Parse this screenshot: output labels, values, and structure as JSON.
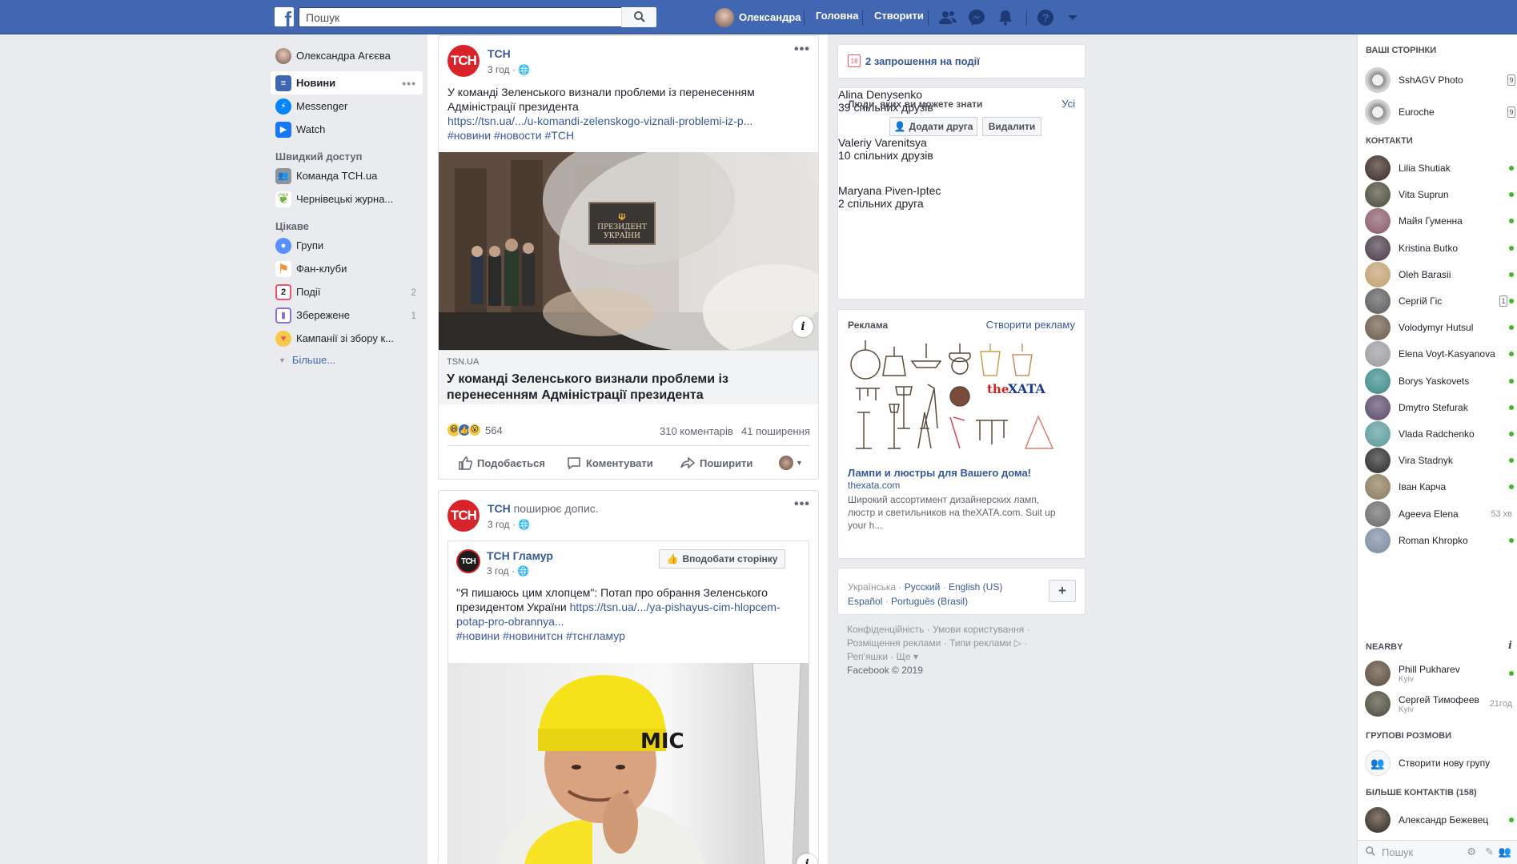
{
  "topbar": {
    "search_placeholder": "Пошук",
    "user_name": "Олександра",
    "home": "Головна",
    "create": "Створити"
  },
  "left": {
    "profile": "Олександра Агєєва",
    "nav": [
      {
        "label": "Новини",
        "icon": "news-feed-icon",
        "color": "#4267b2"
      },
      {
        "label": "Messenger",
        "icon": "messenger-icon",
        "color": "#0084ff"
      },
      {
        "label": "Watch",
        "icon": "watch-icon",
        "color": "#1877f2"
      }
    ],
    "shortcuts_title": "Швидкий доступ",
    "shortcuts": [
      {
        "label": "Команда TCH.ua",
        "icon": "group-icon",
        "color": "#8d949e"
      },
      {
        "label": "Чернівецькі журна...",
        "icon": "leaf-icon",
        "color": "#7cb342"
      }
    ],
    "explore_title": "Цікаве",
    "explore": [
      {
        "label": "Групи",
        "icon": "groups-icon",
        "color": "#5890ff",
        "count": ""
      },
      {
        "label": "Фан-клуби",
        "icon": "flag-icon",
        "color": "#f7923b",
        "count": ""
      },
      {
        "label": "Події",
        "icon": "calendar-icon",
        "color": "#f35369",
        "count": "2"
      },
      {
        "label": "Збережене",
        "icon": "bookmark-icon",
        "color": "#8c72cb",
        "count": "1"
      },
      {
        "label": "Кампанії зі збору к...",
        "icon": "fundraiser-icon",
        "color": "#f35369",
        "count": ""
      }
    ],
    "more": "Більше..."
  },
  "post1": {
    "author": "ТСН",
    "avatar_text": "ТСН",
    "time": "3 год",
    "text_line1": "У команді Зеленського визнали проблеми із перенесенням",
    "text_line2": "Адміністрації президента",
    "link": "https://tsn.ua/.../u-komandi-zelenskogo-viznali-problemi-iz-p...",
    "tags": "#новини #новости #ТСН",
    "plaque": "ПРЕЗИДЕНТ УКРАЇНИ",
    "domain": "TSN.UA",
    "headline_line1": "У команді Зеленського визнали проблеми із",
    "headline_line2": "перенесенням Адміністрації президента",
    "reactions": "564",
    "comments": "310 коментарів",
    "shares": "41 поширення",
    "like": "Подобається",
    "comment": "Коментувати",
    "share": "Поширити"
  },
  "post2": {
    "author": "ТСН",
    "avatar_text": "ТСН",
    "shared_text": "поширює допис.",
    "time": "3 год",
    "inner_author": "ТСН Гламур",
    "inner_avatar_text": "ТСН",
    "inner_time": "3 год",
    "like_page": "Вподобати сторінку",
    "text_line1": "\"Я пишаюсь цим хлопцем\": Потап про обрання Зеленського",
    "text_line2_plain": "президентом України",
    "text_line2_link": "https://tsn.ua/.../ya-pishayus-cim-hlopcem-",
    "text_line3_link": "potap-pro-obrannya...",
    "tags": "#новини #новинитсн #тснгламур"
  },
  "right": {
    "events": "2 запрошення на події",
    "events_day": "18",
    "pymk_title": "Люди, яких ви можете знати",
    "pymk_all": "Усі",
    "pymk": [
      {
        "name": "Alina Denysenko",
        "mutual": "39 спільних друзів",
        "color": "#6b5243"
      },
      {
        "name": "Valeriy Varenitsya",
        "mutual": "10 спільних друзів",
        "color": "#c9a98b"
      },
      {
        "name": "Maryana Piven-Iptec",
        "mutual": "2 спільних друга",
        "color": "#3b2a2a"
      }
    ],
    "add_friend": "Додати друга",
    "remove": "Видалити",
    "ads_title": "Реклама",
    "create_ad": "Створити рекламу",
    "ad_logo": "theXATA",
    "ad_title": "Лампи и люстры для Вашего дома!",
    "ad_domain": "thexata.com",
    "ad_desc_line1": "Широкий ассортимент дизайнерских ламп,",
    "ad_desc_line2": "люстр и светильников на theXATA.com. Suit up",
    "ad_desc_line3": "your h...",
    "lang_current": "Українська",
    "langs": [
      "Русский",
      "English (US)",
      "Español",
      "Português (Brasil)"
    ],
    "footer_line1": "Конфіденційність · Умови користування ·",
    "footer_line2": "Розміщення реклами · Типи реклами ▷ ·",
    "footer_line3": "Реп'яшки · Ще ▾",
    "copyright": "Facebook © 2019"
  },
  "chat": {
    "pages_title": "Ваші сторінки",
    "pages": [
      {
        "name": "SshAGV Photo",
        "badge": "9"
      },
      {
        "name": "Euroche",
        "badge": "9"
      }
    ],
    "contacts_title": "Контакти",
    "contacts": [
      {
        "name": "Lilia Shutiak",
        "color": "#3a2a22",
        "status": "online"
      },
      {
        "name": "Vita Suprun",
        "color": "#4a4a3a",
        "status": "online"
      },
      {
        "name": "Майя Гуменна",
        "color": "#8a5a6a",
        "status": "online"
      },
      {
        "name": "Kristina Butko",
        "color": "#4a3a4a",
        "status": "online"
      },
      {
        "name": "Oleh Barasii",
        "color": "#c0a070",
        "status": "online"
      },
      {
        "name": "Сергій Гіс",
        "color": "#5a5a5a",
        "status": "badge",
        "badge": "1"
      },
      {
        "name": "Volodymyr Hutsul",
        "color": "#6a5a4a",
        "status": "online"
      },
      {
        "name": "Elena Voyt-Kasyanova",
        "color": "#9a9aa0",
        "status": "online"
      },
      {
        "name": "Borys Yaskovets",
        "color": "#3a8a8a",
        "status": "online"
      },
      {
        "name": "Dmytro Stefurak",
        "color": "#5a4a6a",
        "status": "online"
      },
      {
        "name": "Vlada Radchenko",
        "color": "#5a9a9a",
        "status": "online"
      },
      {
        "name": "Vira Stadnyk",
        "color": "#2a2a2a",
        "status": "online"
      },
      {
        "name": "Іван Карча",
        "color": "#8a7a5a",
        "status": "online"
      },
      {
        "name": "Ageeva Elena",
        "color": "#6a6a6a",
        "status": "time",
        "time": "53 хв"
      },
      {
        "name": "Roman Khropko",
        "color": "#7a8aa0",
        "status": "online"
      }
    ],
    "nearby_title": "Nearby",
    "nearby": [
      {
        "name": "Phill Pukharev",
        "sub": "Kyiv",
        "color": "#5a4a3a",
        "status": "online"
      },
      {
        "name": "Сергей Тимофеев",
        "sub": "Kyiv",
        "color": "#4a4a3a",
        "status": "time",
        "time": "21год"
      }
    ],
    "groups_title": "Групові розмови",
    "create_group": "Створити нову групу",
    "more_contacts_title": "Більше контактів (158)",
    "more_contacts": [
      {
        "name": "Александр Бежевец",
        "color": "#3a3a3a",
        "status": "online"
      }
    ],
    "search_placeholder": "Пошук"
  }
}
